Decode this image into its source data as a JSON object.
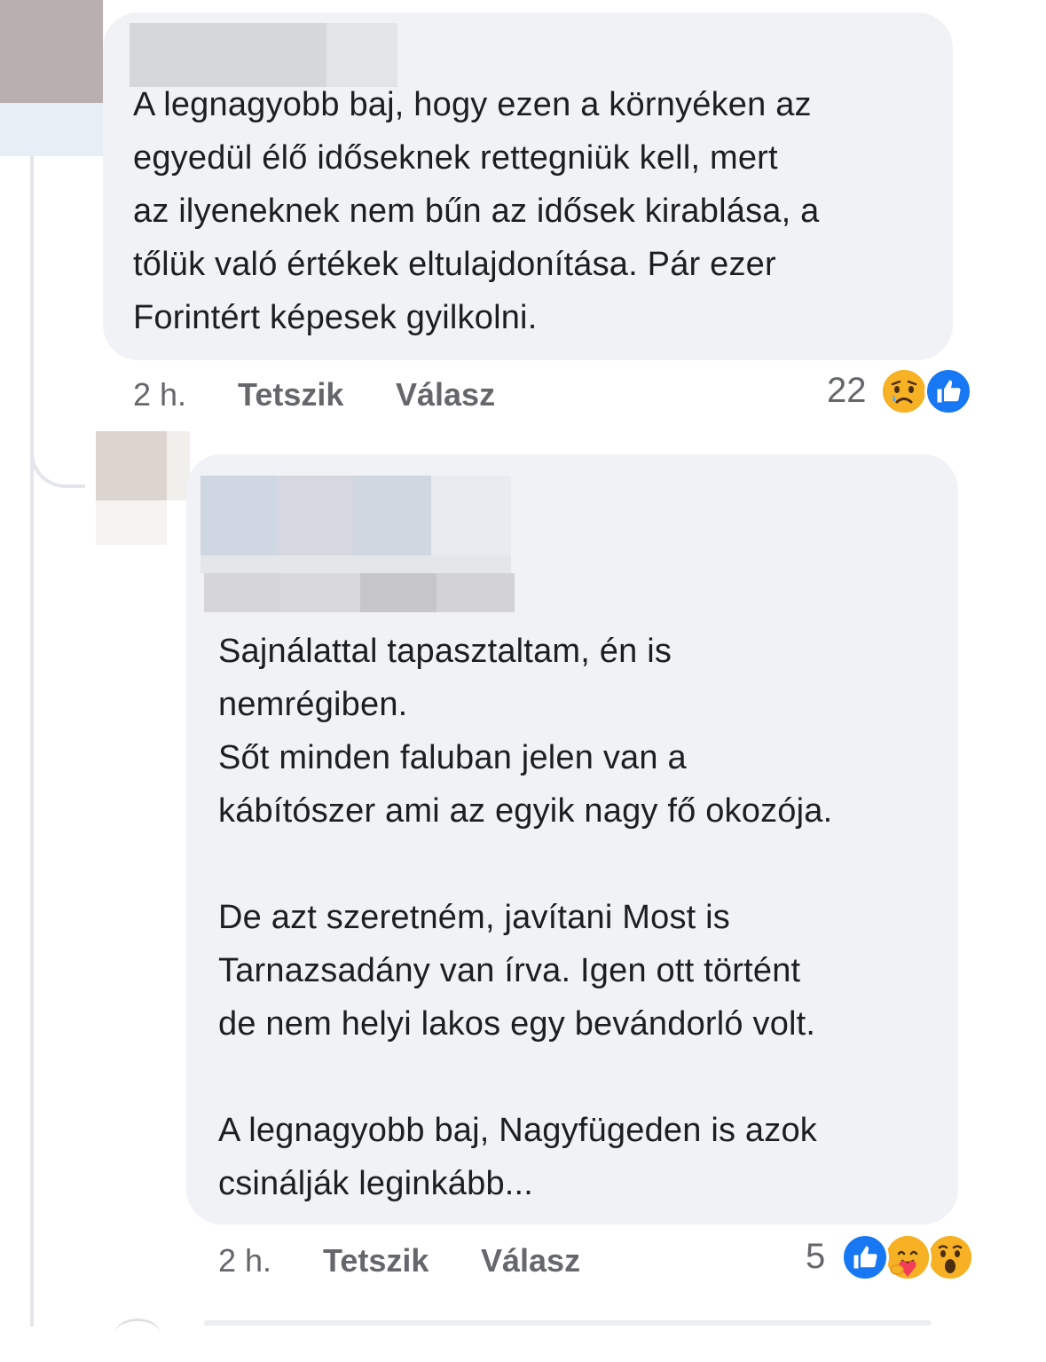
{
  "comments": [
    {
      "text": "A legnagyobb baj, hogy ezen a környéken az\negyedül élő időseknek rettegniük kell, mert\naz ilyeneknek nem bűn az idősek kirablása, a\ntőlük való értékek eltulajdonítása. Pár ezer\nForintért képesek gyilkolni.",
      "time": "2 h.",
      "like_label": "Tetszik",
      "reply_label": "Válasz",
      "reaction_count": "22",
      "reactions": [
        "sad-reaction",
        "like-reaction"
      ]
    },
    {
      "text": "Sajnálattal tapasztaltam, én is\nnemrégiben.\nSőt minden faluban jelen van a\nkábítószer ami az egyik nagy fő okozója.\n\nDe azt szeretném, javítani Most is\nTarnazsadány van írva. Igen ott történt\nde nem helyi lakos egy bevándorló volt.\n\nA legnagyobb baj, Nagyfügeden is azok\ncsinálják leginkább...",
      "time": "2 h.",
      "like_label": "Tetszik",
      "reply_label": "Válasz",
      "reaction_count": "5",
      "reactions": [
        "like-reaction",
        "care-reaction",
        "wow-reaction"
      ]
    }
  ],
  "colors": {
    "bubble": "#f0f2f5",
    "meta_text": "#65676b",
    "like_blue": "#1877f2",
    "emoji_yellow": "#f7b125"
  }
}
